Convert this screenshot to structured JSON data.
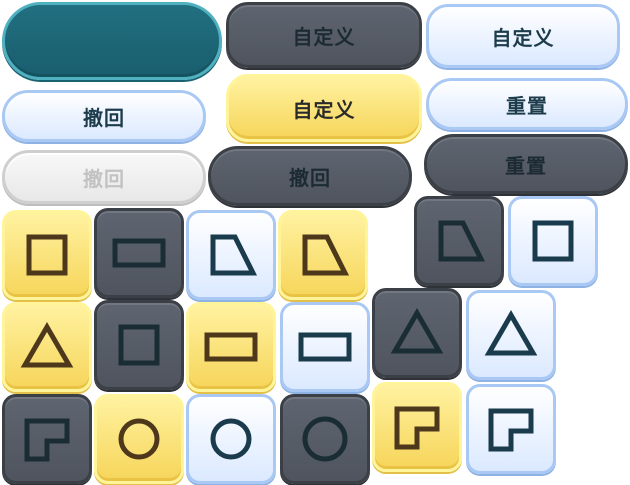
{
  "buttons": {
    "custom": "自定义",
    "undo": "撤回",
    "reset": "重置"
  },
  "icons": {
    "square": "square-icon",
    "rectangle": "rectangle-icon",
    "trapezoid": "trapezoid-icon",
    "triangle": "triangle-icon",
    "circle": "circle-icon",
    "l_shape": "l-shape-icon"
  },
  "colors": {
    "yellow": "#f6d55a",
    "dark": "#565b65",
    "light": "#dbe9ff",
    "teal": "#1d6878"
  }
}
